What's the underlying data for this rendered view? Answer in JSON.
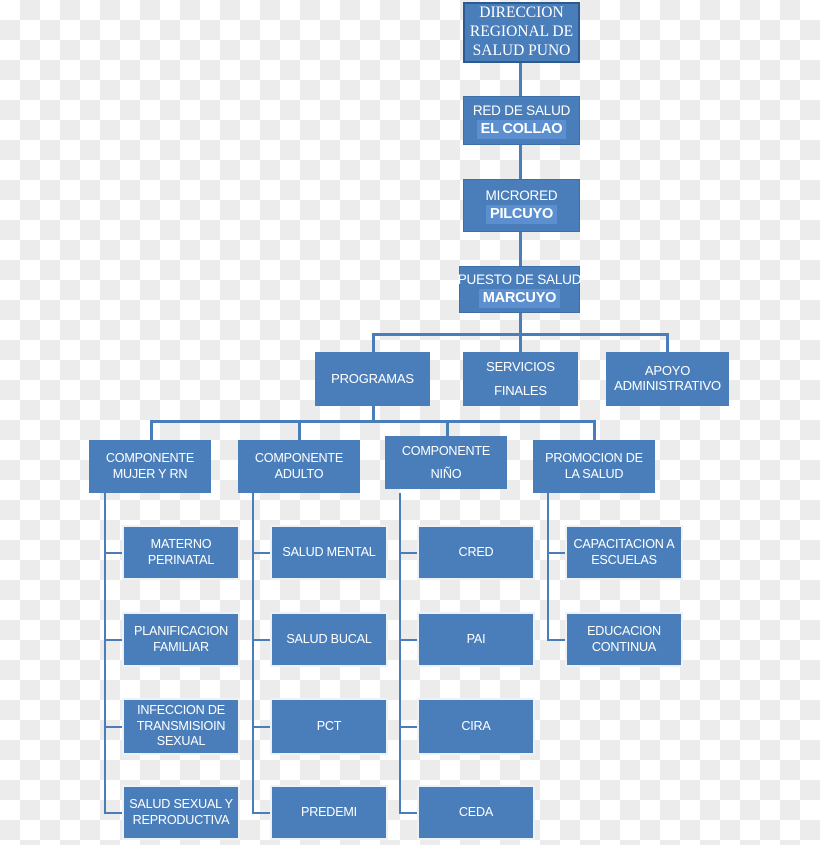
{
  "document": {
    "type": "organizational-chart",
    "title": "DIRECCION REGIONAL DE SALUD PUNO"
  },
  "colors": {
    "box_fill": "#4a7ebb",
    "box_border_dark": "#2e5b8f",
    "box_border_light": "#eef2f7",
    "connector": "#4a7ebb",
    "highlight": "#5b8fd0",
    "text": "#ffffff",
    "background_checker_light": "#ffffff",
    "background_checker_dark": "#ececec"
  },
  "chart_data": {
    "type": "diagram",
    "title": "DIRECCION REGIONAL DE SALUD PUNO",
    "orientation": "top-down hierarchical tree",
    "levels": 5
  },
  "nodes": {
    "root": {
      "line1": "DIRECCION",
      "line2": "REGIONAL DE",
      "line3": "SALUD PUNO"
    },
    "red": {
      "line1": "RED DE SALUD",
      "line2": "EL COLLAO"
    },
    "microred": {
      "line1": "MICRORED",
      "line2": "PILCUYO"
    },
    "puesto": {
      "line1": "PUESTO DE SALUD",
      "line2": "MARCUYO"
    },
    "programas": {
      "line1": "PROGRAMAS"
    },
    "servicios": {
      "line1": "SERVICIOS",
      "line2": "FINALES"
    },
    "apoyo": {
      "line1": "APOYO",
      "line2": "ADMINISTRATIVO"
    },
    "comp_mujer": {
      "line1": "COMPONENTE",
      "line2": "MUJER Y RN"
    },
    "comp_adulto": {
      "line1": "COMPONENTE",
      "line2": "ADULTO"
    },
    "comp_nino": {
      "line1": "COMPONENTE",
      "line2": "NIÑO"
    },
    "promocion": {
      "line1": "PROMOCION DE",
      "line2": "LA SALUD"
    },
    "mujer_1": {
      "line1": "MATERNO",
      "line2": "PERINATAL"
    },
    "mujer_2": {
      "line1": "PLANIFICACION",
      "line2": "FAMILIAR"
    },
    "mujer_3": {
      "line1": "INFECCION DE",
      "line2": "TRANSMISIOIN",
      "line3": "SEXUAL"
    },
    "mujer_4": {
      "line1": "SALUD SEXUAL Y",
      "line2": "REPRODUCTIVA"
    },
    "adulto_1": {
      "line1": "SALUD MENTAL"
    },
    "adulto_2": {
      "line1": "SALUD BUCAL"
    },
    "adulto_3": {
      "line1": "PCT"
    },
    "adulto_4": {
      "line1": "PREDEMI"
    },
    "nino_1": {
      "line1": "CRED"
    },
    "nino_2": {
      "line1": "PAI"
    },
    "nino_3": {
      "line1": "CIRA"
    },
    "nino_4": {
      "line1": "CEDA"
    },
    "promo_1": {
      "line1": "CAPACITACION A",
      "line2": "ESCUELAS"
    },
    "promo_2": {
      "line1": "EDUCACION",
      "line2": "CONTINUA"
    }
  }
}
